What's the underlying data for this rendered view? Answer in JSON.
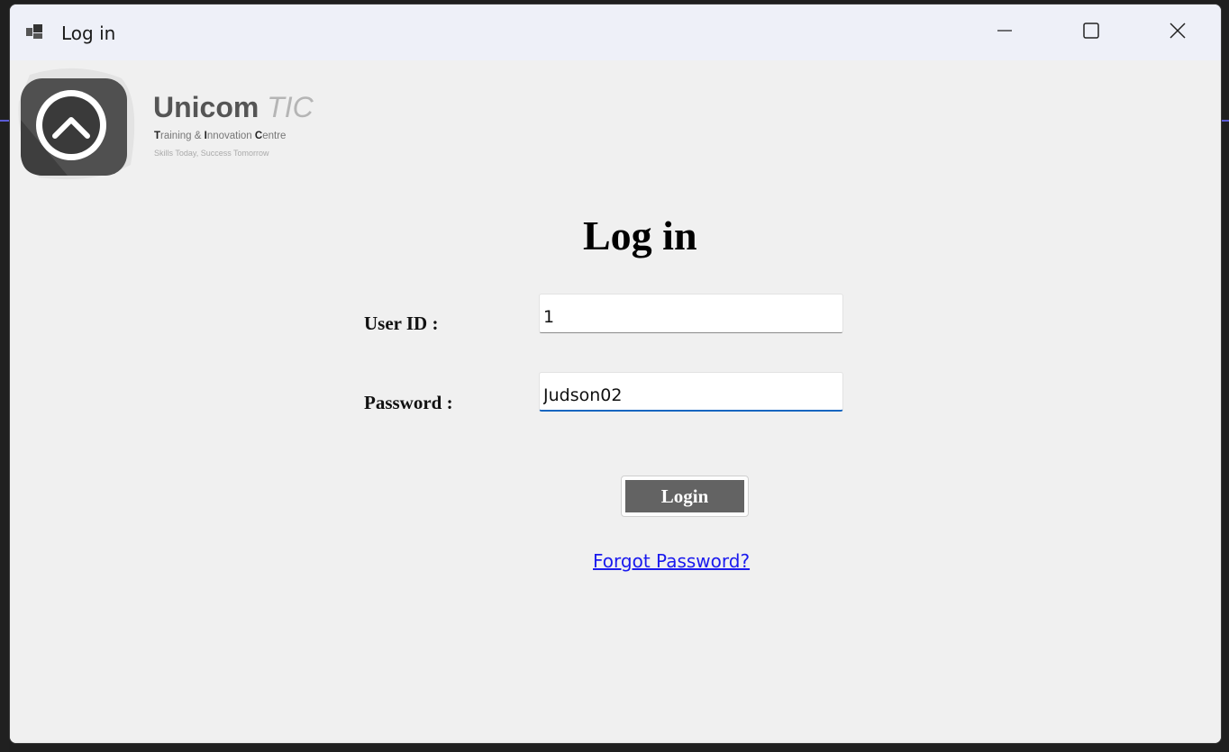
{
  "window": {
    "title": "Log in",
    "controls": [
      "minimize-icon",
      "maximize-icon",
      "close-icon"
    ]
  },
  "logo": {
    "name_main": "Unicom",
    "name_accent": "TIC",
    "subtitle_parts": [
      {
        "t": "T",
        "b": true
      },
      {
        "t": "raining & ",
        "b": false
      },
      {
        "t": "I",
        "b": true
      },
      {
        "t": "nnovation ",
        "b": false
      },
      {
        "t": "C",
        "b": true
      },
      {
        "t": "entre",
        "b": false
      }
    ],
    "tagline": "Skills Today, Success Tomorrow"
  },
  "form": {
    "heading": "Log in",
    "user_label": "User ID :",
    "user_value": "1",
    "password_label": "Password :",
    "password_value": "Judson02",
    "login_label": "Login",
    "forgot_link": "Forgot Password?"
  },
  "colors": {
    "window_bg": "#f0f0f0",
    "titlebar_bg": "#eef0f8",
    "login_button_bg": "#636363",
    "focus_underline": "#1566c0",
    "link": "#1a1aee"
  }
}
